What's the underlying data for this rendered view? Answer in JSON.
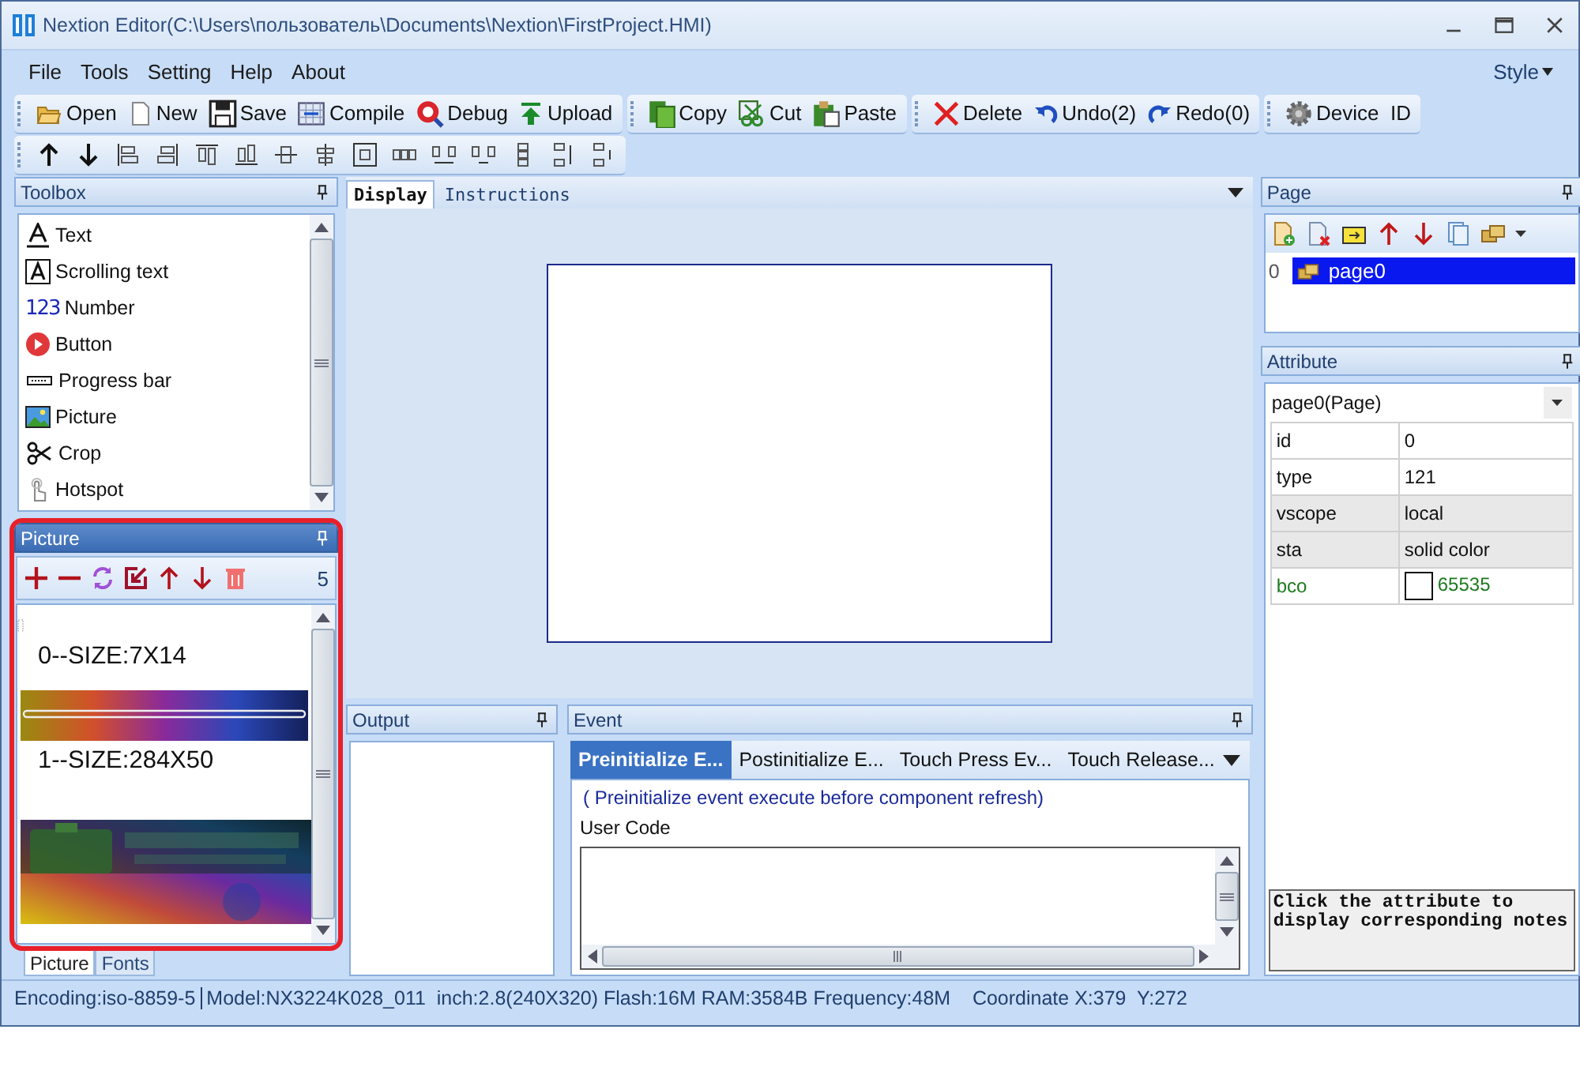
{
  "window": {
    "title": "Nextion Editor(C:\\Users\\пользователь\\Documents\\Nextion\\FirstProject.HMI)"
  },
  "menu": [
    {
      "label": "File"
    },
    {
      "label": "Tools"
    },
    {
      "label": "Setting"
    },
    {
      "label": "Help"
    },
    {
      "label": "About"
    }
  ],
  "style_menu": {
    "label": "Style"
  },
  "toolbar_groups": [
    [
      {
        "label": "Open",
        "kind": "open"
      },
      {
        "label": "New",
        "kind": "new"
      },
      {
        "label": "Save",
        "kind": "save"
      },
      {
        "label": "Compile",
        "kind": "compile"
      },
      {
        "label": "Debug",
        "kind": "debug"
      },
      {
        "label": "Upload",
        "kind": "upload"
      }
    ],
    [
      {
        "label": "Copy",
        "kind": "copy"
      },
      {
        "label": "Cut",
        "kind": "cut"
      },
      {
        "label": "Paste",
        "kind": "paste"
      }
    ],
    [
      {
        "label": "Delete",
        "kind": "delete"
      },
      {
        "label": "Undo(2)",
        "kind": "undo"
      },
      {
        "label": "Redo(0)",
        "kind": "redo"
      }
    ],
    [
      {
        "label": "Device  ID",
        "kind": "gear"
      }
    ]
  ],
  "toolbox": {
    "title": "Toolbox",
    "items": [
      {
        "label": "Text",
        "kind": "text"
      },
      {
        "label": "Scrolling text",
        "kind": "scroll"
      },
      {
        "label": "Number",
        "kind": "number",
        "glyph": "123"
      },
      {
        "label": "Button",
        "kind": "button"
      },
      {
        "label": "Progress bar",
        "kind": "progress"
      },
      {
        "label": "Picture",
        "kind": "picture"
      },
      {
        "label": "Crop",
        "kind": "crop"
      },
      {
        "label": "Hotspot",
        "kind": "hotspot"
      }
    ]
  },
  "picture_panel": {
    "title": "Picture",
    "count": "5",
    "items": [
      {
        "kind": "glyph",
        "label": "0--SIZE:7X14"
      },
      {
        "kind": "picture",
        "label": "1--SIZE:284X50"
      },
      {
        "kind": "picture"
      }
    ],
    "tabs": [
      {
        "label": "Picture",
        "selected": true
      },
      {
        "label": "Fonts",
        "selected": false
      }
    ]
  },
  "editor": {
    "tabs": [
      {
        "label": "Display",
        "selected": true
      },
      {
        "label": "Instructions",
        "selected": false
      }
    ]
  },
  "output": {
    "title": "Output"
  },
  "event": {
    "title": "Event",
    "tabs": [
      {
        "label": "Preinitialize E...",
        "selected": true
      },
      {
        "label": "Postinitialize E...",
        "selected": false
      },
      {
        "label": "Touch Press Ev...",
        "selected": false
      },
      {
        "label": "Touch Release...",
        "selected": false
      }
    ],
    "hint": "( Preinitialize event execute before component refresh)",
    "code_label": "User Code"
  },
  "page_panel": {
    "title": "Page",
    "pages": [
      {
        "index": "0",
        "name": "page0",
        "selected": true
      }
    ]
  },
  "attribute": {
    "title": "Attribute",
    "object": "page0(Page)",
    "rows": [
      {
        "name": "id",
        "value": "0",
        "kind": "editable"
      },
      {
        "name": "type",
        "value": "121",
        "kind": "editable"
      },
      {
        "name": "vscope",
        "value": "local",
        "kind": "fixed"
      },
      {
        "name": "sta",
        "value": "solid color",
        "kind": "fixed"
      },
      {
        "name": "bco",
        "value": "65535",
        "kind": "color"
      }
    ],
    "notes": "Click the attribute to display corresponding notes"
  },
  "status_bar": [
    "Encoding:iso-8859-5",
    "Model:NX3224K028_011  inch:2.8(240X320) Flash:16M RAM:3584B Frequency:48M    Coordinate X:379  Y:272"
  ]
}
